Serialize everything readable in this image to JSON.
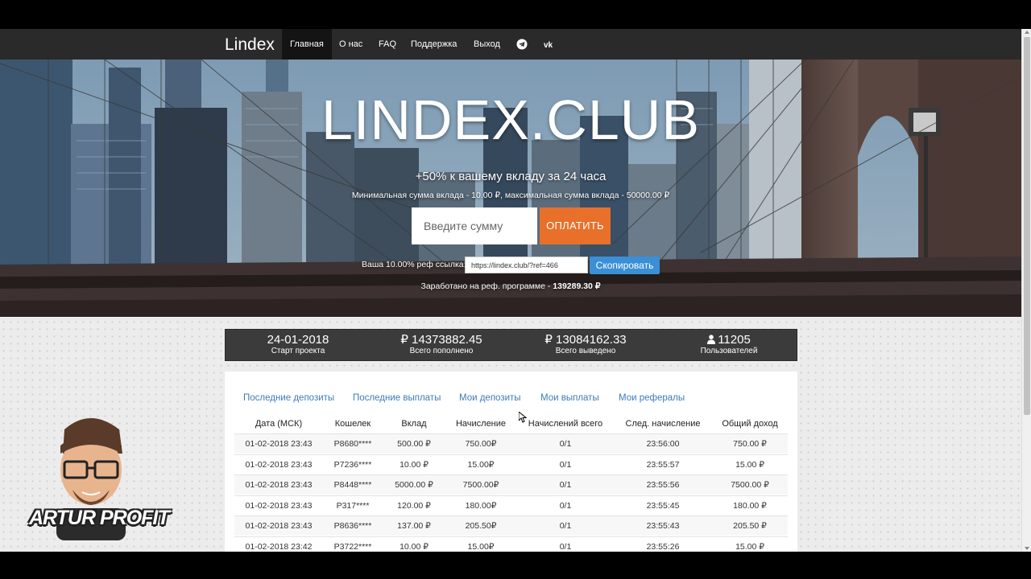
{
  "nav": {
    "brand": "Lindex",
    "items": [
      {
        "label": "Главная",
        "active": true
      },
      {
        "label": "О нас"
      },
      {
        "label": "FAQ"
      },
      {
        "label": "Поддержка"
      },
      {
        "label": "Выход"
      }
    ],
    "icons": [
      "telegram-icon",
      "vk-icon"
    ]
  },
  "hero": {
    "title": "LINDEX.CLUB",
    "subtitle": "+50% к вашему вкладу за 24 часа",
    "info": "Минимальная сумма вклада - 10.00 ₽, максимальная сумма вклада - 50000.00 ₽",
    "amount_placeholder": "Введите сумму",
    "pay_label": "ОПЛАТИТЬ",
    "ref_label": "Ваша 10.00% реф ссылка:",
    "ref_value": "https://lindex.club/?ref=466",
    "copy_label": "Скопировать",
    "earned_label": "Заработано на реф. программе - ",
    "earned_value": "139289.30 ₽"
  },
  "stats": [
    {
      "value": "24-01-2018",
      "label": "Старт проекта"
    },
    {
      "value": "₽ 14373882.45",
      "label": "Всего пополнено"
    },
    {
      "value": "₽ 13084162.33",
      "label": "Всего выведено"
    },
    {
      "value": "11205",
      "label": "Пользователей",
      "icon": "user-icon"
    }
  ],
  "tabs": [
    "Последние депозиты",
    "Последние выплаты",
    "Мои депозиты",
    "Мои выплаты",
    "Мои рефералы"
  ],
  "table": {
    "headers": [
      "Дата (МСК)",
      "Кошелек",
      "Вклад",
      "Начисление",
      "Начислений всего",
      "След. начисление",
      "Общий доход"
    ],
    "rows": [
      [
        "01-02-2018 23:43",
        "P8680****",
        "500.00 ₽",
        "750.00₽",
        "0/1",
        "23:56:00",
        "750.00 ₽"
      ],
      [
        "01-02-2018 23:43",
        "P7236****",
        "10.00 ₽",
        "15.00₽",
        "0/1",
        "23:55:57",
        "15.00 ₽"
      ],
      [
        "01-02-2018 23:43",
        "P8448****",
        "5000.00 ₽",
        "7500.00₽",
        "0/1",
        "23:55:56",
        "7500.00 ₽"
      ],
      [
        "01-02-2018 23:43",
        "P317****",
        "120.00 ₽",
        "180.00₽",
        "0/1",
        "23:55:45",
        "180.00 ₽"
      ],
      [
        "01-02-2018 23:43",
        "P8636****",
        "137.00 ₽",
        "205.50₽",
        "0/1",
        "23:55:43",
        "205.50 ₽"
      ],
      [
        "01-02-2018 23:42",
        "P3722****",
        "10.00 ₽",
        "15.00₽",
        "0/1",
        "23:55:26",
        "15.00 ₽"
      ]
    ]
  },
  "watermark": "ARTUR PROFIT"
}
